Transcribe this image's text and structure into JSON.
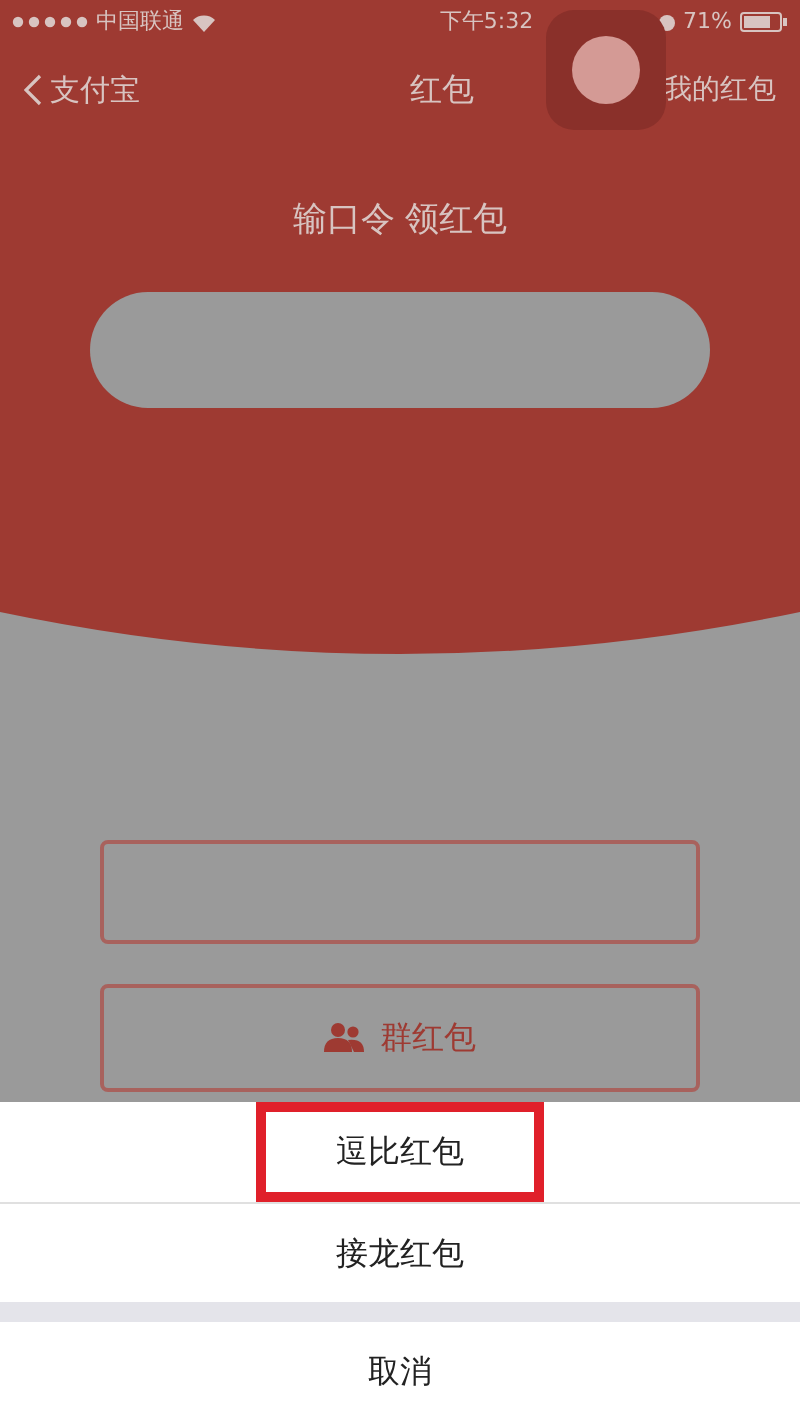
{
  "status_bar": {
    "carrier": "中国联通",
    "time": "下午5:32",
    "battery": "71%"
  },
  "nav": {
    "back": "支付宝",
    "title": "红包",
    "action": "我的红包"
  },
  "header": {
    "prompt": "输口令 领红包"
  },
  "group_button": {
    "label": "群红包"
  },
  "action_sheet": {
    "options": [
      {
        "label": "逗比红包",
        "highlighted": true
      },
      {
        "label": "接龙红包",
        "highlighted": false
      }
    ],
    "cancel": "取消"
  }
}
